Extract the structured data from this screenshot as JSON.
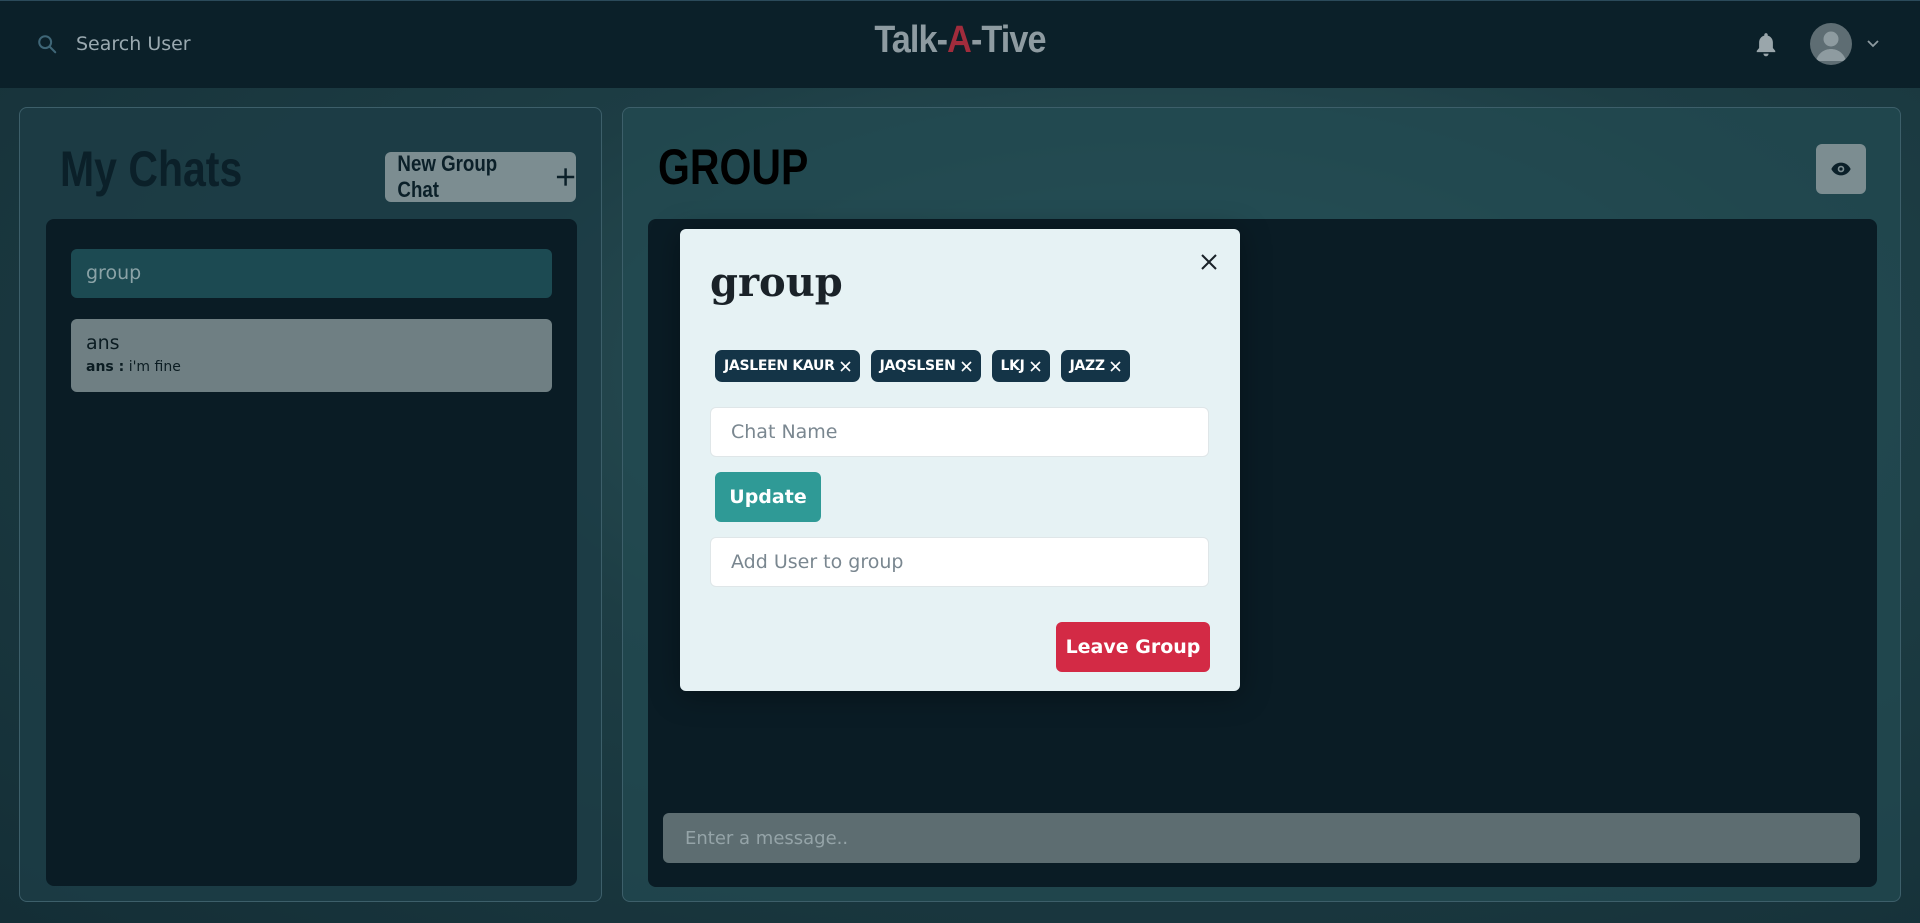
{
  "header": {
    "search_label": "Search User",
    "brand_prefix": "Talk-",
    "brand_accent": "A",
    "brand_suffix": "-Tive",
    "icons": {
      "search": "search-icon",
      "bell": "bell-icon",
      "avatar": "user-avatar-icon",
      "chevron": "chevron-down-icon"
    }
  },
  "sidebar": {
    "title": "My Chats",
    "new_group_label": "New Group Chat",
    "chats": [
      {
        "name": "group",
        "active": true
      },
      {
        "name": "ans",
        "active": false,
        "last_sender": "ans :",
        "last_message": "i'm fine"
      }
    ]
  },
  "chat": {
    "title": "GROUP",
    "message_placeholder": "Enter a message.."
  },
  "modal": {
    "title": "group",
    "members": [
      {
        "name": "JASLEEN KAUR"
      },
      {
        "name": "JAQSLSEN"
      },
      {
        "name": "LKJ"
      },
      {
        "name": "JAZZ"
      }
    ],
    "chat_name_placeholder": "Chat Name",
    "update_label": "Update",
    "add_user_placeholder": "Add User to group",
    "leave_label": "Leave Group"
  },
  "colors": {
    "topbar": "#0b2029",
    "brand_accent": "#a12c3c",
    "update_button": "#2f9a96",
    "leave_button": "#d32a45",
    "member_tag": "#143447",
    "active_chat": "#1c4a52"
  }
}
